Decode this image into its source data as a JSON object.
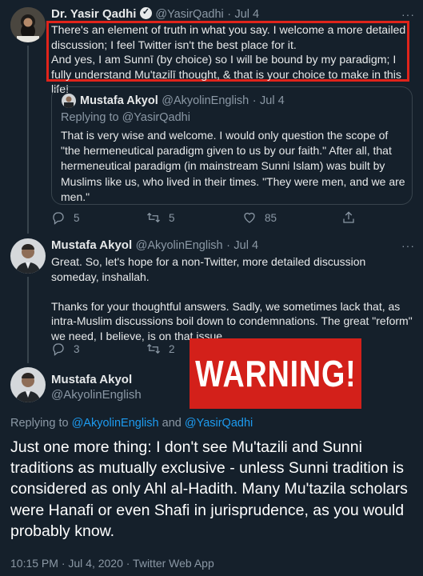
{
  "tweet1": {
    "name": "Dr. Yasir Qadhi",
    "handle": "@YasirQadhi",
    "sep": "·",
    "date": "Jul 4",
    "text": "There's an element of truth in what you say. I welcome a more detailed discussion; I feel Twitter isn't the best place for it.\nAnd yes, I am Sunnī (by choice) so I will be bound by my paradigm; I fully understand Mu'tazilī thought, & that is your choice to make in this life!",
    "highlight_color": "#e0241b"
  },
  "quoted": {
    "name": "Mustafa Akyol",
    "handle": "@AkyolinEnglish",
    "sep": "·",
    "date": "Jul 4",
    "replying": "Replying to @YasirQadhi",
    "text": "That is very wise and welcome. I would only question the scope of \"the hermeneutical paradigm given to us by our faith.\" After all, that hermeneutical paradigm (in mainstream Sunni Islam) was built by Muslims like us, who lived in their times. \"They were men, and we are men.\""
  },
  "tweet1_actions": {
    "replies": "5",
    "retweets": "5",
    "likes": "85"
  },
  "tweet2": {
    "name": "Mustafa Akyol",
    "handle": "@AkyolinEnglish",
    "sep": "·",
    "date": "Jul 4",
    "text": "Great. So, let's hope for a non-Twitter, more detailed discussion someday, inshallah.\n\nThanks for your thoughtful answers. Sadly, we sometimes lack that, as intra-Muslim discussions boil down to condemnations. The great \"reform\" we need, I believe, is on that issue."
  },
  "tweet2_actions": {
    "replies": "3",
    "retweets": "2"
  },
  "warning": {
    "label": "WARNING!",
    "color": "#d3201a"
  },
  "main": {
    "name": "Mustafa Akyol",
    "handle": "@AkyolinEnglish",
    "replying_prefix": "Replying to",
    "replying_user1": "@AkyolinEnglish",
    "replying_and": "and",
    "replying_user2": "@YasirQadhi",
    "text": "Just one more thing: I don't see Mu'tazili and Sunni traditions as mutually exclusive - unless Sunni tradition is considered as only Ahl al-Hadith. Many Mu'tazila scholars were Hanafi or even Shafi in jurisprudence, as you would probably know.",
    "timestamp": "10:15 PM · Jul 4, 2020 · Twitter Web App"
  }
}
